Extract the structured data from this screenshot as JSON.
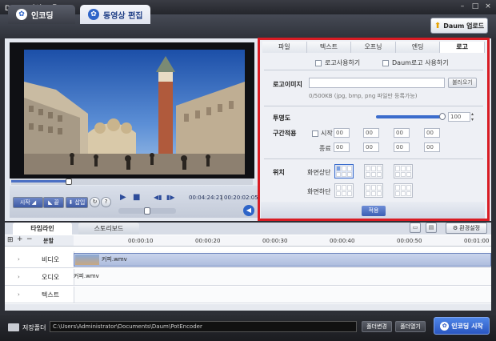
{
  "titlebar": {
    "title": "Daum 팟인코더",
    "menu_arrow": "▾",
    "min": "–",
    "max": "□",
    "close": "×"
  },
  "main_tabs": [
    {
      "label": "인코딩",
      "icon": "film-reel-icon"
    },
    {
      "label": "동영상 편집",
      "icon": "film-reel-icon"
    }
  ],
  "upload_button": {
    "label": "Daum 업로드",
    "icon": "upload-arrow-icon"
  },
  "player": {
    "progress_fraction": 0.24,
    "start_label": "시작",
    "end_label": "끝",
    "insert_label": "삽입",
    "help": "?",
    "current_time": "00:04:24:21",
    "total_time": "00:20:02:05"
  },
  "panel": {
    "tabs": [
      "파일",
      "텍스트",
      "오프닝",
      "엔딩",
      "로고"
    ],
    "active_tab": "로고",
    "use_logo_label": "로고사용하기",
    "use_daum_logo_label": "Daum로고 사용하기",
    "logo_image_label": "로고이미지",
    "browse_label": "불러오기",
    "file_hint": "0/500KB (jpg, bmp, png 파일만 등록가능)",
    "opacity_label": "투명도",
    "opacity_value": "100",
    "range_label": "구간적용",
    "start_label": "시작",
    "end_label": "종료",
    "time_value": "00",
    "position_label": "위치",
    "top_label": "화면상단",
    "bottom_label": "화면하단",
    "apply_label": "적용"
  },
  "timeline": {
    "tabs": [
      "타임라인",
      "스토리보드"
    ],
    "env_label": "환경설정",
    "split_label": "분할",
    "zoom_in": "+",
    "zoom_out": "−",
    "ticks": [
      "00:00:10",
      "00:00:20",
      "00:00:30",
      "00:00:40",
      "00:00:50",
      "00:01:00"
    ],
    "tracks": [
      {
        "name": "비디오",
        "clip": "커피.wmv"
      },
      {
        "name": "오디오",
        "clip": "커피.wmv"
      },
      {
        "name": "텍스트",
        "clip": ""
      }
    ]
  },
  "bottom": {
    "save_folder_label": "저장폴더",
    "path": "C:\\Users\\Administrator\\Documents\\Daum\\PotEncoder",
    "change_folder": "폴더변경",
    "open_folder": "폴더열기",
    "start_encoding": "인코딩 시작"
  },
  "colors": {
    "accent": "#2e64c8",
    "highlight_border": "#d91c24"
  }
}
